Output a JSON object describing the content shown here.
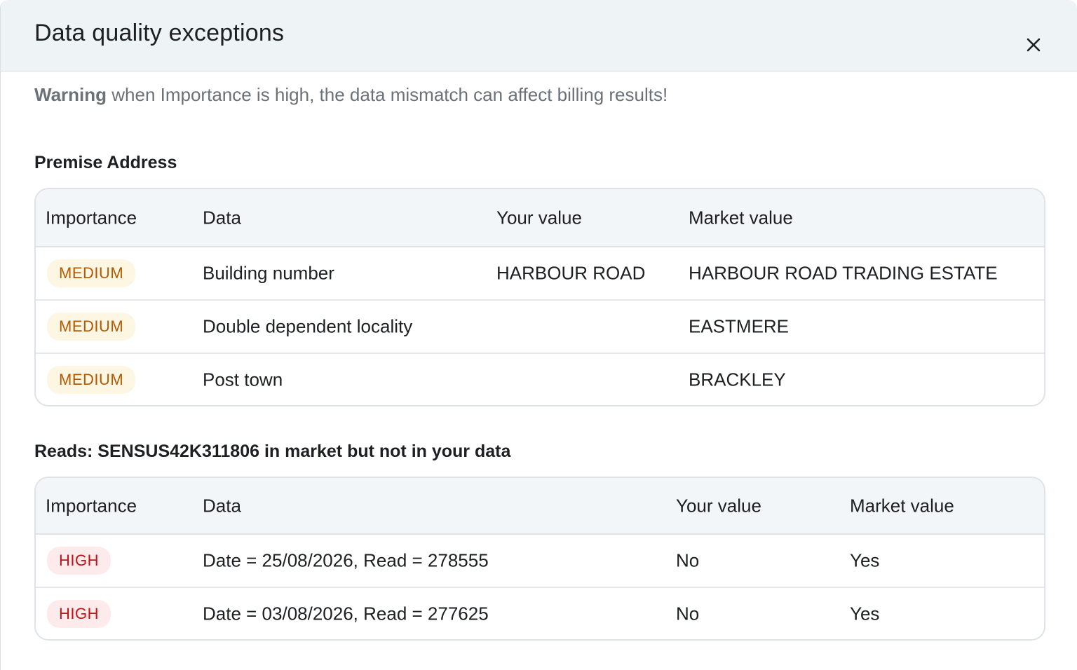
{
  "modal": {
    "title": "Data quality exceptions",
    "close_icon": "close-icon"
  },
  "warning": {
    "label": "Warning",
    "text": " when Importance is high, the data mismatch can affect billing results!"
  },
  "premise_section": {
    "title": "Premise Address",
    "headers": [
      "Importance",
      "Data",
      "Your value",
      "Market value"
    ],
    "rows": [
      {
        "importance": "MEDIUM",
        "data": "Building number",
        "your_value": "HARBOUR ROAD",
        "market_value": "HARBOUR ROAD TRADING ESTATE"
      },
      {
        "importance": "MEDIUM",
        "data": "Double dependent locality",
        "your_value": "",
        "market_value": "EASTMERE"
      },
      {
        "importance": "MEDIUM",
        "data": "Post town",
        "your_value": "",
        "market_value": "BRACKLEY"
      }
    ]
  },
  "reads_section": {
    "title": "Reads: SENSUS42K311806 in market but not in your data",
    "headers": [
      "Importance",
      "Data",
      "Your value",
      "Market value"
    ],
    "rows": [
      {
        "importance": "HIGH",
        "data": "Date = 25/08/2026, Read = 278555",
        "your_value": "No",
        "market_value": "Yes"
      },
      {
        "importance": "HIGH",
        "data": "Date = 03/08/2026, Read = 277625",
        "your_value": "No",
        "market_value": "Yes"
      }
    ]
  },
  "colors": {
    "header_bg": "#eef3f6",
    "medium_badge_text": "#b35a00",
    "medium_badge_bg": "#fdf6e3",
    "high_badge_text": "#c0121c",
    "high_badge_bg": "#fdebeb"
  }
}
